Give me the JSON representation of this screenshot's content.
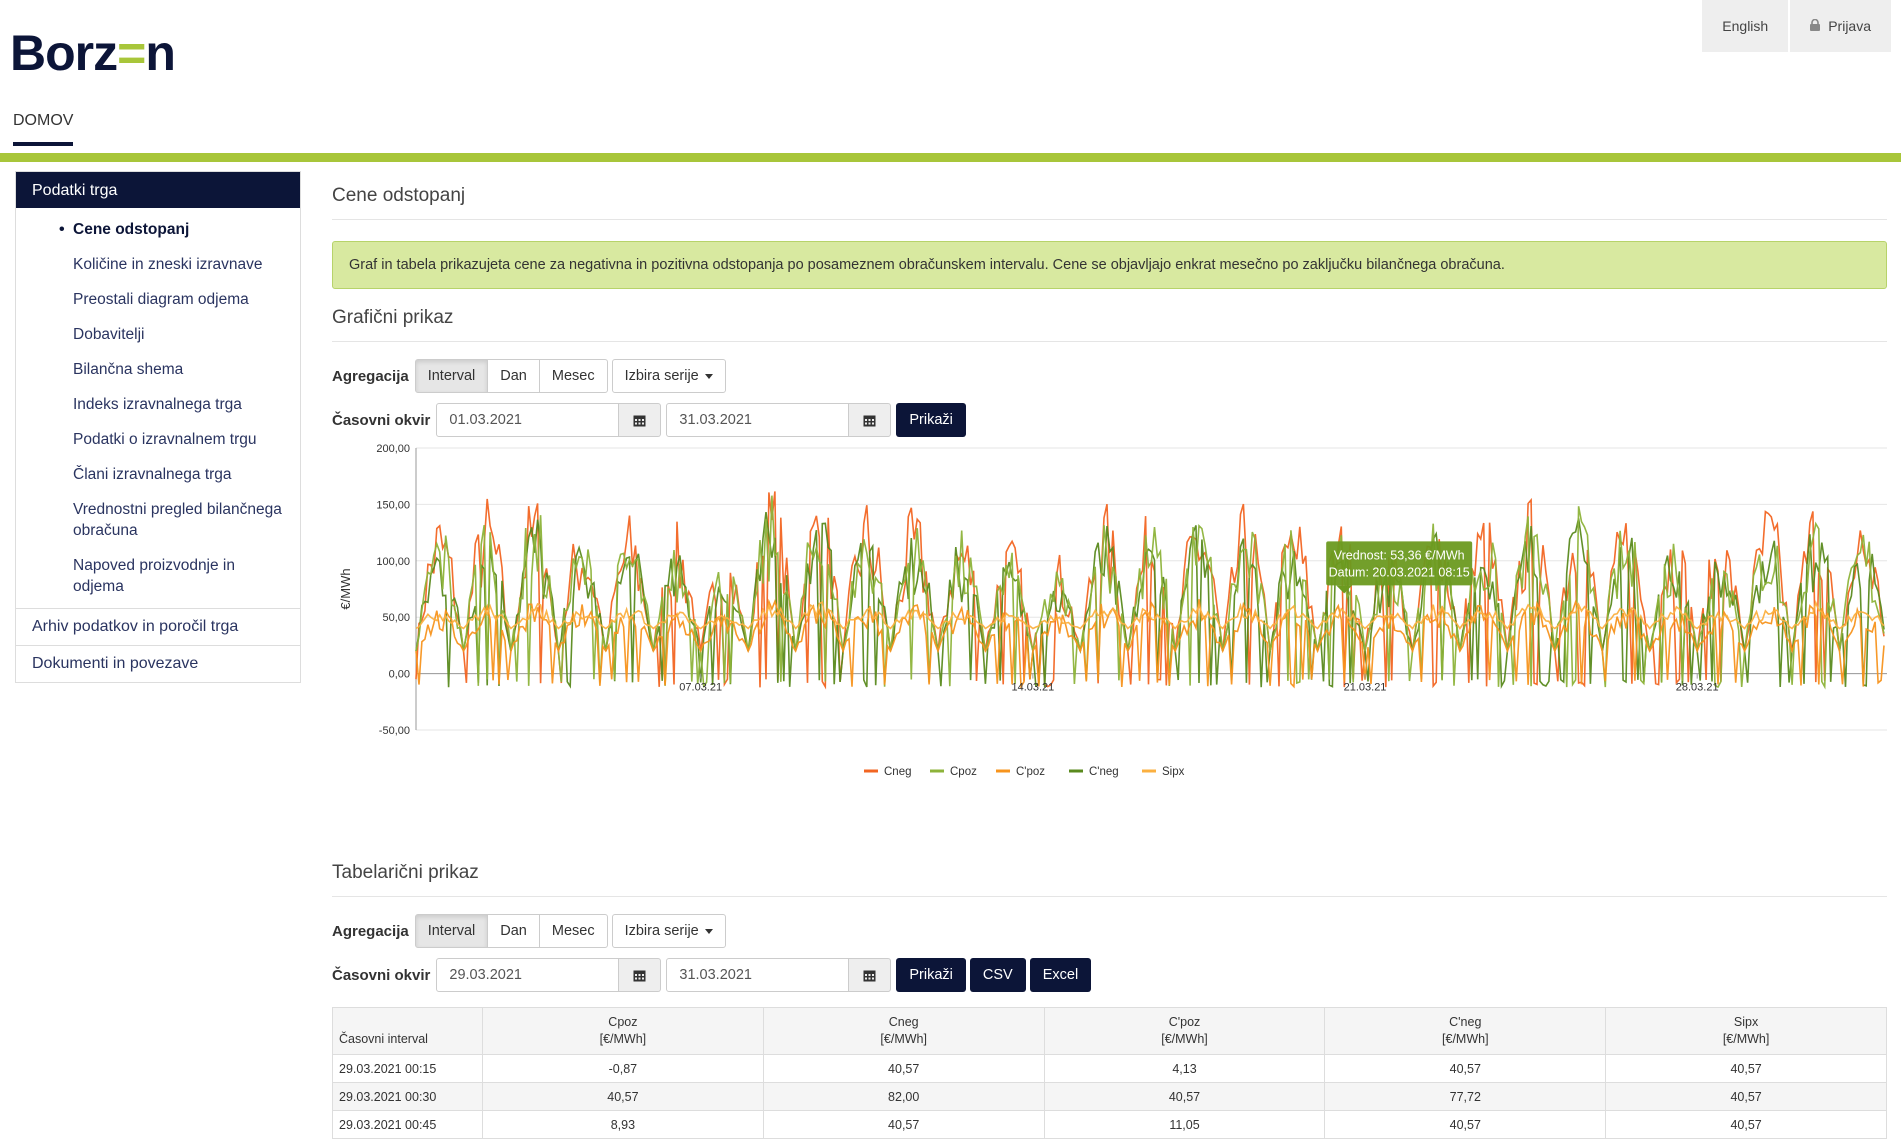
{
  "brand": {
    "logo_left": "Borz",
    "logo_accent": "=",
    "logo_right": "n"
  },
  "topbar": {
    "language": "English",
    "login": "Prijava"
  },
  "nav": {
    "home": "DOMOV"
  },
  "sidebar": {
    "section_title": "Podatki trga",
    "sub_items": [
      "Cene odstopanj",
      "Količine in zneski izravnave",
      "Preostali diagram odjema",
      "Dobavitelji",
      "Bilančna shema",
      "Indeks izravnalnega trga",
      "Podatki o izravnalnem trgu",
      "Člani izravnalnega trga",
      "Vrednostni pregled bilančnega obračuna",
      "Napoved proizvodnje in odjema"
    ],
    "active_index": 0,
    "items": [
      "Arhiv podatkov in poročil trga",
      "Dokumenti in povezave"
    ]
  },
  "page": {
    "title": "Cene odstopanj",
    "info": "Graf in tabela prikazujeta cene za negativna in pozitivna odstopanja po posameznem obračunskem intervalu. Cene se objavljajo enkrat mesečno po zaključku bilančnega obračuna."
  },
  "graph_section": {
    "title": "Grafični prikaz",
    "aggregation_label": "Agregacija",
    "aggregation_options": [
      "Interval",
      "Dan",
      "Mesec"
    ],
    "series_dropdown": "Izbira serije",
    "time_label": "Časovni okvir",
    "date_from": "01.03.2021",
    "date_to": "31.03.2021",
    "show_button": "Prikaži"
  },
  "chart_data": {
    "type": "line",
    "ylabel": "€/MWh",
    "ylim": [
      -50,
      200
    ],
    "yticks": [
      "200,00",
      "150,00",
      "100,00",
      "50,00",
      "0,00",
      "-50,00"
    ],
    "ytick_values": [
      200,
      150,
      100,
      50,
      0,
      -50
    ],
    "x_range": [
      "01.03.2021 00:15",
      "31.03.2021 24:00"
    ],
    "xticks": [
      {
        "label": "07.03.21",
        "day": 7
      },
      {
        "label": "14.03.21",
        "day": 14
      },
      {
        "label": "21.03.21",
        "day": 21
      },
      {
        "label": "28.03.21",
        "day": 28
      }
    ],
    "grid": true,
    "legend_position": "bottom",
    "series": [
      {
        "name": "Cneg",
        "color": "#f26522"
      },
      {
        "name": "Cpoz",
        "color": "#8db33a"
      },
      {
        "name": "C'poz",
        "color": "#f7941d"
      },
      {
        "name": "C'neg",
        "color": "#5a8a1e"
      },
      {
        "name": "Sipx",
        "color": "#fbb040"
      }
    ],
    "daily_peaks": [
      {
        "day": 1,
        "Cneg": 152,
        "Cpoz": 140,
        "Cpoz_prime": 60,
        "Cneg_prime": 130,
        "Sipx": 58
      },
      {
        "day": 2,
        "Cneg": 162,
        "Cpoz": 150,
        "Cpoz_prime": 65,
        "Cneg_prime": 145,
        "Sipx": 62
      },
      {
        "day": 3,
        "Cneg": 165,
        "Cpoz": 155,
        "Cpoz_prime": 68,
        "Cneg_prime": 150,
        "Sipx": 63
      },
      {
        "day": 4,
        "Cneg": 140,
        "Cpoz": 125,
        "Cpoz_prime": 62,
        "Cneg_prime": 120,
        "Sipx": 60
      },
      {
        "day": 5,
        "Cneg": 145,
        "Cpoz": 130,
        "Cpoz_prime": 64,
        "Cneg_prime": 125,
        "Sipx": 61
      },
      {
        "day": 6,
        "Cneg": 135,
        "Cpoz": 115,
        "Cpoz_prime": 58,
        "Cneg_prime": 110,
        "Sipx": 56
      },
      {
        "day": 7,
        "Cneg": 120,
        "Cpoz": 105,
        "Cpoz_prime": 55,
        "Cneg_prime": 100,
        "Sipx": 52
      },
      {
        "day": 8,
        "Cneg": 172,
        "Cpoz": 160,
        "Cpoz_prime": 70,
        "Cneg_prime": 155,
        "Sipx": 66
      },
      {
        "day": 9,
        "Cneg": 170,
        "Cpoz": 158,
        "Cpoz_prime": 70,
        "Cneg_prime": 150,
        "Sipx": 65
      },
      {
        "day": 10,
        "Cneg": 160,
        "Cpoz": 148,
        "Cpoz_prime": 66,
        "Cneg_prime": 140,
        "Sipx": 63
      },
      {
        "day": 11,
        "Cneg": 150,
        "Cpoz": 138,
        "Cpoz_prime": 64,
        "Cneg_prime": 130,
        "Sipx": 61
      },
      {
        "day": 12,
        "Cneg": 140,
        "Cpoz": 128,
        "Cpoz_prime": 62,
        "Cneg_prime": 120,
        "Sipx": 60
      },
      {
        "day": 13,
        "Cneg": 125,
        "Cpoz": 110,
        "Cpoz_prime": 58,
        "Cneg_prime": 105,
        "Sipx": 55
      },
      {
        "day": 14,
        "Cneg": 110,
        "Cpoz": 95,
        "Cpoz_prime": 55,
        "Cneg_prime": 90,
        "Sipx": 52
      },
      {
        "day": 15,
        "Cneg": 155,
        "Cpoz": 142,
        "Cpoz_prime": 66,
        "Cneg_prime": 135,
        "Sipx": 62
      },
      {
        "day": 16,
        "Cneg": 150,
        "Cpoz": 138,
        "Cpoz_prime": 64,
        "Cneg_prime": 130,
        "Sipx": 61
      },
      {
        "day": 17,
        "Cneg": 160,
        "Cpoz": 148,
        "Cpoz_prime": 67,
        "Cneg_prime": 140,
        "Sipx": 63
      },
      {
        "day": 18,
        "Cneg": 155,
        "Cpoz": 142,
        "Cpoz_prime": 65,
        "Cneg_prime": 135,
        "Sipx": 62
      },
      {
        "day": 19,
        "Cneg": 150,
        "Cpoz": 140,
        "Cpoz_prime": 64,
        "Cneg_prime": 130,
        "Sipx": 61
      },
      {
        "day": 20,
        "Cneg": 140,
        "Cpoz": 128,
        "Cpoz_prime": 62,
        "Cneg_prime": 120,
        "Sipx": 60
      },
      {
        "day": 21,
        "Cneg": 130,
        "Cpoz": 115,
        "Cpoz_prime": 58,
        "Cneg_prime": 110,
        "Sipx": 56
      },
      {
        "day": 22,
        "Cneg": 155,
        "Cpoz": 142,
        "Cpoz_prime": 65,
        "Cneg_prime": 135,
        "Sipx": 62
      },
      {
        "day": 23,
        "Cneg": 150,
        "Cpoz": 138,
        "Cpoz_prime": 64,
        "Cneg_prime": 130,
        "Sipx": 61
      },
      {
        "day": 24,
        "Cneg": 158,
        "Cpoz": 146,
        "Cpoz_prime": 66,
        "Cneg_prime": 138,
        "Sipx": 62
      },
      {
        "day": 25,
        "Cneg": 162,
        "Cpoz": 150,
        "Cpoz_prime": 67,
        "Cneg_prime": 142,
        "Sipx": 63
      },
      {
        "day": 26,
        "Cneg": 150,
        "Cpoz": 138,
        "Cpoz_prime": 64,
        "Cneg_prime": 130,
        "Sipx": 61
      },
      {
        "day": 27,
        "Cneg": 140,
        "Cpoz": 128,
        "Cpoz_prime": 62,
        "Cneg_prime": 120,
        "Sipx": 60
      },
      {
        "day": 28,
        "Cneg": 135,
        "Cpoz": 120,
        "Cpoz_prime": 58,
        "Cneg_prime": 112,
        "Sipx": 56
      },
      {
        "day": 29,
        "Cneg": 158,
        "Cpoz": 146,
        "Cpoz_prime": 66,
        "Cneg_prime": 138,
        "Sipx": 62
      },
      {
        "day": 30,
        "Cneg": 162,
        "Cpoz": 150,
        "Cpoz_prime": 67,
        "Cneg_prime": 142,
        "Sipx": 63
      },
      {
        "day": 31,
        "Cneg": 150,
        "Cpoz": 136,
        "Cpoz_prime": 64,
        "Cneg_prime": 128,
        "Sipx": 61
      }
    ],
    "tooltip": {
      "line1": "Vrednost: 53,36 €/MWh",
      "line2": "Datum: 20.03.2021 08:15",
      "day": 20.35,
      "value": 53.36
    }
  },
  "table_section": {
    "title": "Tabelarični prikaz",
    "aggregation_label": "Agregacija",
    "aggregation_options": [
      "Interval",
      "Dan",
      "Mesec"
    ],
    "series_dropdown": "Izbira serije",
    "time_label": "Časovni okvir",
    "date_from": "29.03.2021",
    "date_to": "31.03.2021",
    "show_button": "Prikaži",
    "csv_button": "CSV",
    "excel_button": "Excel",
    "columns": [
      {
        "name": "Časovni interval",
        "unit": ""
      },
      {
        "name": "Cpoz",
        "unit": "[€/MWh]"
      },
      {
        "name": "Cneg",
        "unit": "[€/MWh]"
      },
      {
        "name": "C'poz",
        "unit": "[€/MWh]"
      },
      {
        "name": "C'neg",
        "unit": "[€/MWh]"
      },
      {
        "name": "Sipx",
        "unit": "[€/MWh]"
      }
    ],
    "rows": [
      [
        "29.03.2021 00:15",
        "-0,87",
        "40,57",
        "4,13",
        "40,57",
        "40,57"
      ],
      [
        "29.03.2021 00:30",
        "40,57",
        "82,00",
        "40,57",
        "77,72",
        "40,57"
      ],
      [
        "29.03.2021 00:45",
        "8,93",
        "40,57",
        "11,05",
        "40,57",
        "40,57"
      ]
    ]
  }
}
